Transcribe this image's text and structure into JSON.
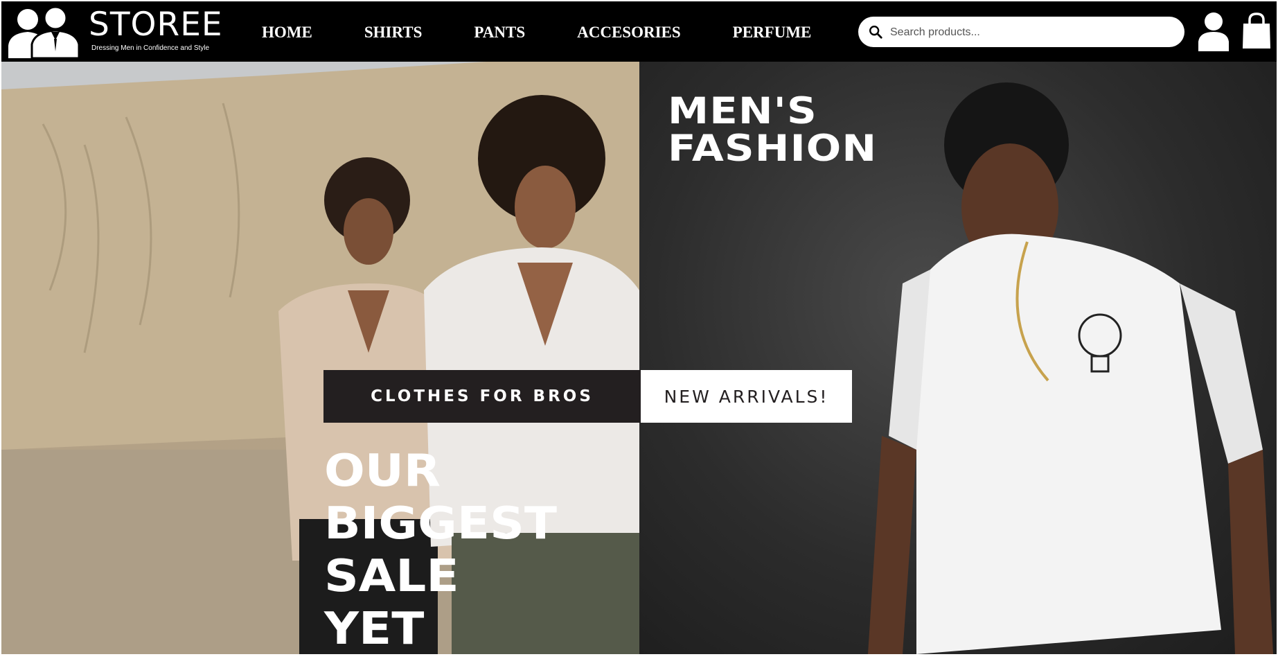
{
  "brand": {
    "name": "STOREE",
    "tagline": "Dressing Men in Confidence and Style"
  },
  "nav": {
    "items": [
      {
        "label": "HOME"
      },
      {
        "label": "SHIRTS"
      },
      {
        "label": "PANTS"
      },
      {
        "label": "ACCESORIES"
      },
      {
        "label": "PERFUME"
      }
    ]
  },
  "search": {
    "placeholder": "Search products...",
    "value": ""
  },
  "hero": {
    "headline_line1": "MEN'S",
    "headline_line2": "FASHION",
    "badge_dark": "CLOTHES FOR BROS",
    "badge_light": "NEW ARRIVALS!",
    "sale_lines": [
      "OUR",
      "BIGGEST",
      "SALE",
      "YET"
    ]
  },
  "colors": {
    "header_bg": "#000000",
    "badge_dark_bg": "#231f20",
    "text_light": "#ffffff"
  },
  "icons": {
    "logo": "two-men-silhouette-icon",
    "search": "search-icon",
    "account": "user-icon",
    "cart": "shopping-bag-icon"
  }
}
